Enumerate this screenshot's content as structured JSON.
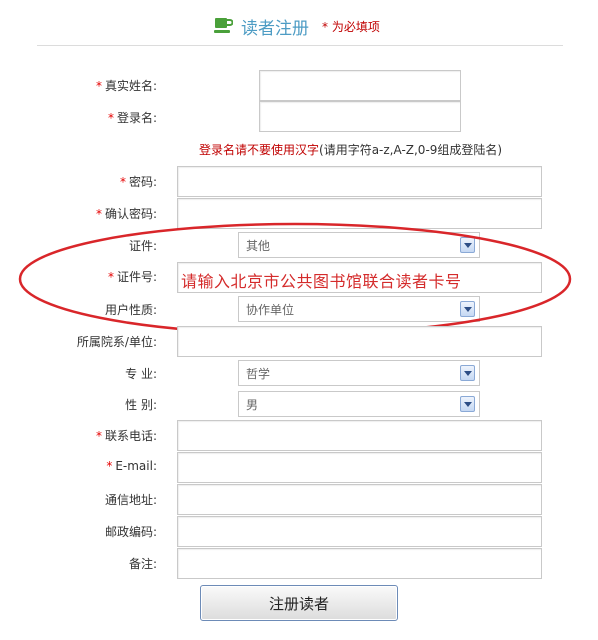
{
  "header": {
    "title": "读者注册",
    "required_note": "* 为必填项",
    "icon": "cup-icon"
  },
  "form": {
    "real_name_label": "真实姓名:",
    "login_name_label": "登录名:",
    "login_hint_red": "登录名请不要使用汉字",
    "login_hint_rest": "(请用字符a-z,A-Z,0-9组成登陆名)",
    "password_label": "密码:",
    "confirm_password_label": "确认密码:",
    "certificate_label": "证件:",
    "certificate_value": "其他",
    "certificate_no_label": "证件号:",
    "certificate_no_annotation": "请输入北京市公共图书馆联合读者卡号",
    "user_type_label": "用户性质:",
    "user_type_value": "协作单位",
    "department_label": "所属院系/单位:",
    "major_label": "专 业:",
    "major_value": "哲学",
    "gender_label": "性 别:",
    "gender_value": "男",
    "phone_label": "联系电话:",
    "email_label": "E-mail:",
    "address_label": "通信地址:",
    "postcode_label": "邮政编码:",
    "remark_label": "备注:",
    "required_star": "*"
  },
  "submit_label": "注册读者",
  "colors": {
    "title": "#4d9cc4",
    "required": "#e60000",
    "annotation": "#d42b2b",
    "ellipse": "#d9262a"
  }
}
